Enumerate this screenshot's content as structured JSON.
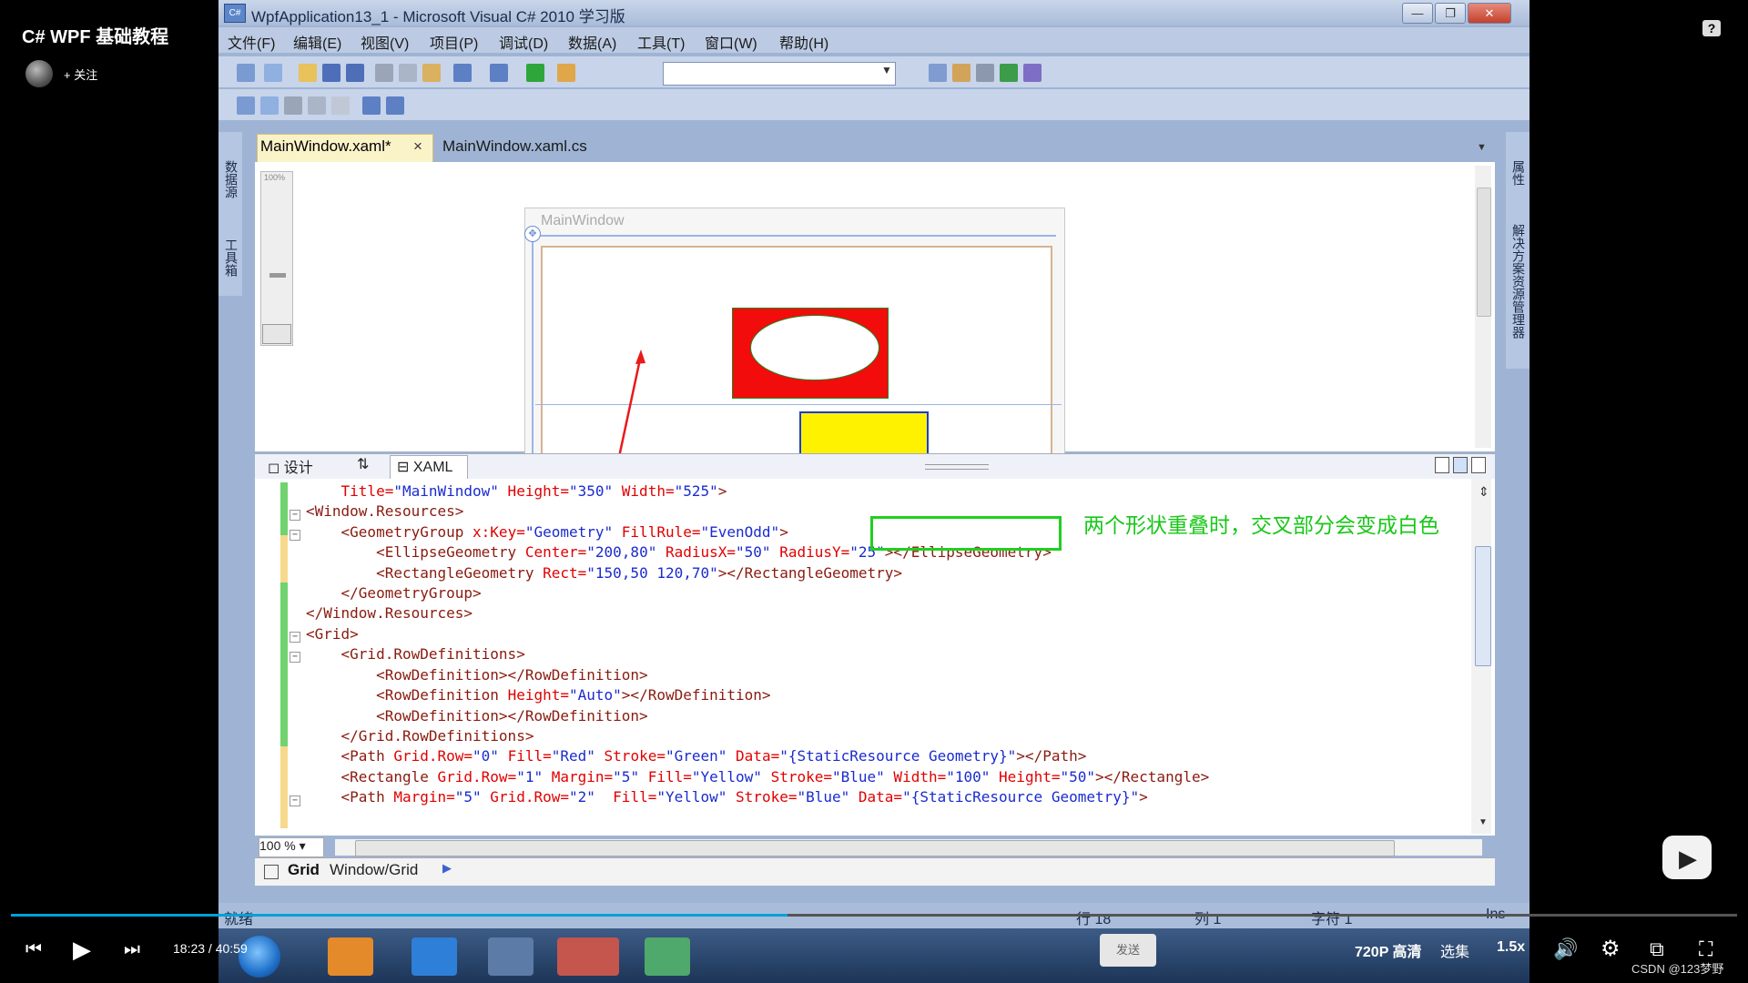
{
  "video": {
    "title": "C# WPF 基础教程",
    "follow": "+ 关注"
  },
  "window": {
    "title": "WpfApplication13_1 - Microsoft Visual C# 2010 学习版",
    "menus": [
      "文件(F)",
      "编辑(E)",
      "视图(V)",
      "项目(P)",
      "调试(D)",
      "数据(A)",
      "工具(T)",
      "窗口(W)",
      "帮助(H)"
    ]
  },
  "side_panels": {
    "left_top": "数据源",
    "left_bottom": "工具箱",
    "right_top": "属性",
    "right_bottom": "解决方案资源管理器"
  },
  "tabs": {
    "active": "MainWindow.xaml*",
    "other": "MainWindow.xaml.cs",
    "close": "×"
  },
  "designer": {
    "window_title": "MainWindow",
    "zoom_label": "100%"
  },
  "view_tabs": {
    "design": "设计",
    "swap": "⇅",
    "xaml": "XAML"
  },
  "code_lines": [
    {
      "tag": "    Title=",
      "v1": "\"MainWindow\"",
      "a2": " Height=",
      "v2": "\"350\"",
      "a3": " Width=",
      "v3": "\"525\"",
      "end": ">"
    },
    {
      "text": "<Window.Resources>"
    },
    {
      "p": "    <GeometryGroup ",
      "a1": "x:Key=",
      "v1": "\"Geometry\"",
      "a2": " FillRule=",
      "v2": "\"EvenOdd\"",
      "end": ">"
    },
    {
      "p": "        <EllipseGeometry ",
      "a1": "Center=",
      "v1": "\"200,80\"",
      "a2": " RadiusX=",
      "v2": "\"50\"",
      "a3": " RadiusY=",
      "v3": "\"25\"",
      "end": "></EllipseGeometry>"
    },
    {
      "p": "        <RectangleGeometry ",
      "a1": "Rect=",
      "v1": "\"150,50 120,70\"",
      "end": "></RectangleGeometry>"
    },
    {
      "text": "    </GeometryGroup>"
    },
    {
      "text": "</Window.Resources>"
    },
    {
      "text": "<Grid>"
    },
    {
      "text": "    <Grid.RowDefinitions>"
    },
    {
      "text": "        <RowDefinition></RowDefinition>"
    },
    {
      "p": "        <RowDefinition ",
      "a1": "Height=",
      "v1": "\"Auto\"",
      "end": "></RowDefinition>"
    },
    {
      "text": "        <RowDefinition></RowDefinition>"
    },
    {
      "text": "    </Grid.RowDefinitions>"
    },
    {
      "p": "    <Path ",
      "a1": "Grid.Row=",
      "v1": "\"0\"",
      "a2": " Fill=",
      "v2": "\"Red\"",
      "a3": " Stroke=",
      "v3": "\"Green\"",
      "a4": " Data=",
      "v4": "\"{StaticResource Geometry}\"",
      "end": "></Path>"
    },
    {
      "p": "    <Rectangle ",
      "a1": "Grid.Row=",
      "v1": "\"1\"",
      "a2": " Margin=",
      "v2": "\"5\"",
      "a3": " Fill=",
      "v3": "\"Yellow\"",
      "a4": " Stroke=",
      "v4": "\"Blue\"",
      "a5": " Width=",
      "v5": "\"100\"",
      "a6": " Height=",
      "v6": "\"50\"",
      "end": "></Rectangle>"
    },
    {
      "p": "    <Path ",
      "a1": "Margin=",
      "v1": "\"5\"",
      "a2": " Grid.Row=",
      "v2": "\"2\"",
      "a3": "  Fill=",
      "v3": "\"Yellow\"",
      "a4": " Stroke=",
      "v4": "\"Blue\"",
      "a5": " Data=",
      "v5": "\"{StaticResource Geometry}\"",
      "end": ">"
    }
  ],
  "annotation": "两个形状重叠时，交叉部分会变成白色",
  "editor": {
    "zoom": "100 %"
  },
  "breadcrumb": {
    "grid": "Grid",
    "path": "Window/Grid"
  },
  "status": {
    "ready": "就绪",
    "row": "行 18",
    "col": "列 1",
    "char": "字符 1",
    "ins": "Ins"
  },
  "player": {
    "time": "18:23 / 40:59",
    "quality": "720P 高清",
    "episodes": "选集",
    "speed": "1.5x",
    "send": "发送",
    "progress": 0.45
  },
  "watermark": "CSDN @123梦野",
  "colors": {
    "annotation": "#18c718",
    "path_fill": "#f20c0c",
    "rect_fill": "#fff200",
    "progress": "#00a1d6"
  }
}
